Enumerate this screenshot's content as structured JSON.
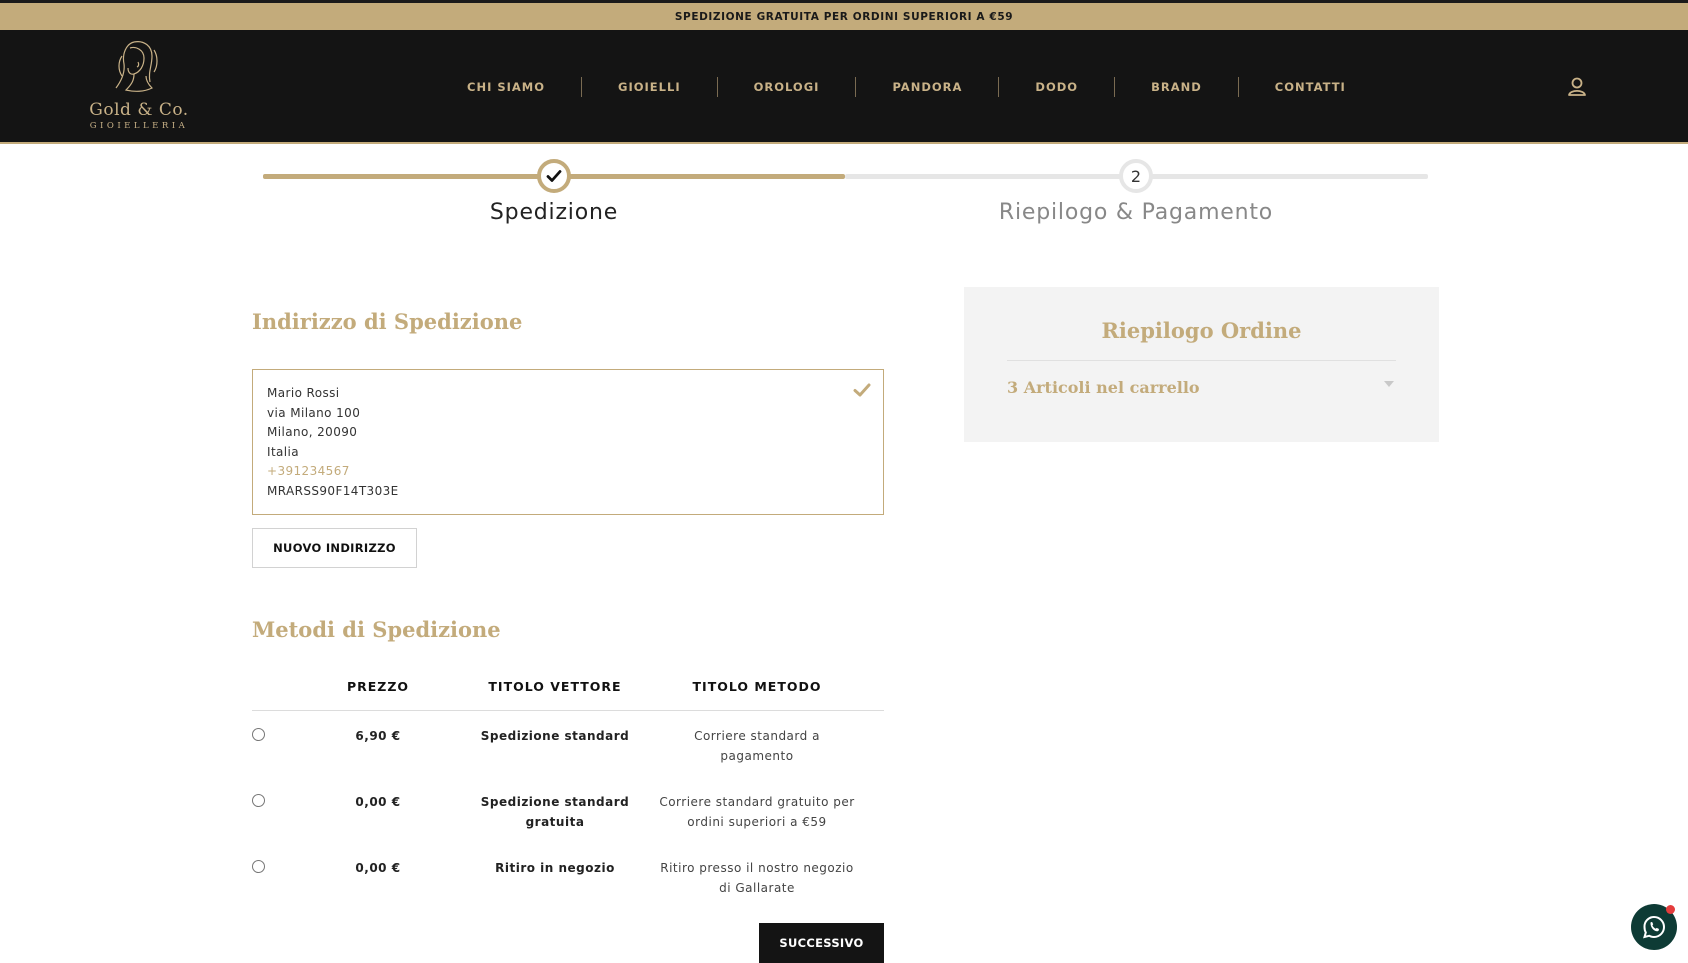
{
  "promo": {
    "text": "SPEDIZIONE GRATUITA PER ORDINI SUPERIORI A €59"
  },
  "header": {
    "logo_name": "Gold & Co.",
    "logo_sub": "GIOIELLERIA",
    "nav": [
      "CHI SIAMO",
      "GIOIELLI",
      "OROLOGI",
      "PANDORA",
      "DODO",
      "BRAND",
      "CONTATTI"
    ],
    "user_icon": "user-icon"
  },
  "stepper": {
    "step1_label": "Spedizione",
    "step2_number": "2",
    "step2_label": "Riepilogo & Pagamento",
    "accent": "#c3ab7b"
  },
  "address": {
    "title": "Indirizzo di Spedizione",
    "name": "Mario Rossi",
    "street": "via Milano 100",
    "city": "Milano, 20090",
    "country": "Italia",
    "phone": "+391234567",
    "tax_code": "MRARSS90F14T303E",
    "new_button": "NUOVO INDIRIZZO"
  },
  "shipping": {
    "title": "Metodi di Spedizione",
    "headers": {
      "price": "PREZZO",
      "carrier": "TITOLO VETTORE",
      "method": "TITOLO METODO"
    },
    "rows": [
      {
        "price": "6,90 €",
        "carrier": "Spedizione standard",
        "method": "Corriere standard a pagamento"
      },
      {
        "price": "0,00 €",
        "carrier": "Spedizione standard gratuita",
        "method": "Corriere standard gratuito per ordini superiori a €59"
      },
      {
        "price": "0,00 €",
        "carrier": "Ritiro in negozio",
        "method": "Ritiro presso il nostro negozio di Gallarate"
      }
    ],
    "next_button": "SUCCESSIVO"
  },
  "summary": {
    "title": "Riepilogo Ordine",
    "items_label": "3 Articoli nel carrello"
  },
  "colors": {
    "gold": "#c3ab7b",
    "dark": "#141414",
    "panel": "#f3f3f3",
    "whatsapp": "#0e3b35"
  }
}
